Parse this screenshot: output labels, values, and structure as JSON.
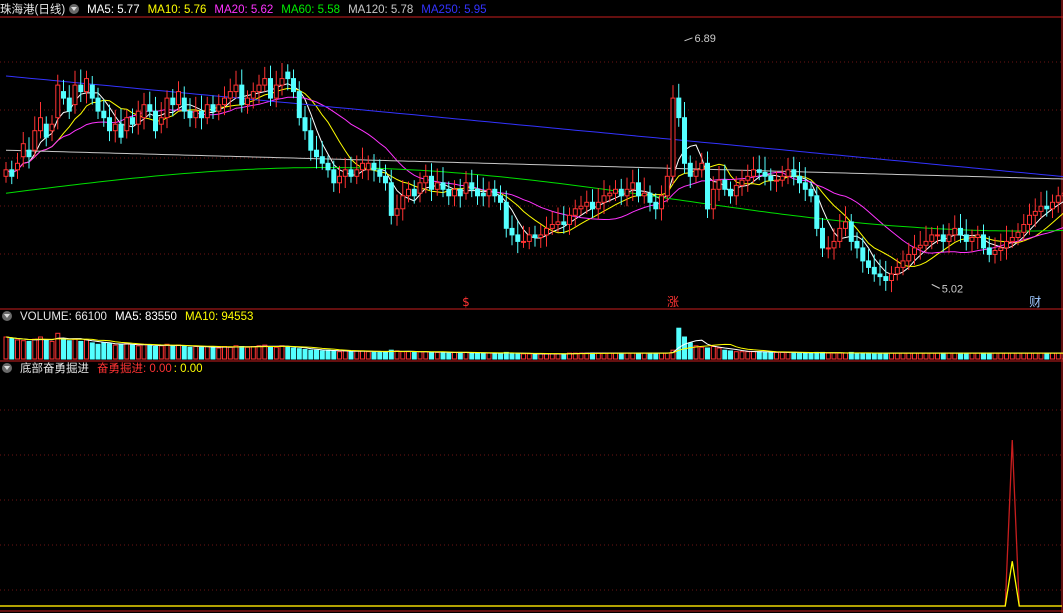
{
  "stock": {
    "title": "珠海港(日线)",
    "ma5": "MA5: 5.77",
    "ma10": "MA10: 5.76",
    "ma20": "MA20: 5.62",
    "ma60": "MA60: 5.58",
    "ma120": "MA120: 5.78",
    "ma250": "MA250: 5.95"
  },
  "volume_panel": {
    "label": "VOLUME: 66100",
    "ma5": "MA5: 83550",
    "ma10": "MA10: 94553"
  },
  "indicator_panel": {
    "label": "底部奋勇掘进",
    "line1": "奋勇掘进: 0.00",
    "line2": ": 0.00"
  },
  "colors": {
    "background": "#000000",
    "frame": "#c81e1e",
    "up": "#ff3333",
    "down": "#54ffff",
    "ma5": "#ffffff",
    "ma10": "#ffff00",
    "ma20": "#ff33ff",
    "ma60": "#00e000",
    "ma120": "#c8c8c8",
    "ma250": "#3333ff",
    "text": "#e6e6e6"
  },
  "chart_data": [
    {
      "type": "candlestick",
      "title": "珠海港(日线)",
      "ylim": [
        4.9,
        7.05
      ],
      "grid": true,
      "annotations": [
        {
          "text": "6.89",
          "bar": 118,
          "value": 6.89
        },
        {
          "text": "5.02",
          "bar": 161,
          "value": 5.02
        },
        {
          "text": "$",
          "bar": 80,
          "kind": "marker"
        },
        {
          "text": "涨",
          "bar": 116,
          "kind": "marker"
        },
        {
          "text": "财",
          "bar": 179,
          "kind": "marker"
        }
      ],
      "close": [
        5.9,
        5.85,
        5.95,
        6.1,
        6.0,
        6.2,
        6.3,
        6.15,
        6.25,
        6.55,
        6.45,
        6.35,
        6.55,
        6.5,
        6.6,
        6.45,
        6.35,
        6.3,
        6.2,
        6.25,
        6.15,
        6.3,
        6.25,
        6.35,
        6.4,
        6.35,
        6.2,
        6.3,
        6.45,
        6.4,
        6.5,
        6.35,
        6.3,
        6.35,
        6.3,
        6.4,
        6.35,
        6.4,
        6.45,
        6.5,
        6.55,
        6.4,
        6.45,
        6.5,
        6.55,
        6.6,
        6.45,
        6.55,
        6.6,
        6.6,
        6.5,
        6.3,
        6.2,
        6.05,
        6.0,
        5.95,
        5.9,
        5.8,
        5.85,
        5.9,
        5.85,
        5.9,
        5.95,
        5.95,
        5.9,
        5.85,
        5.8,
        5.55,
        5.6,
        5.7,
        5.75,
        5.7,
        5.8,
        5.85,
        5.75,
        5.8,
        5.75,
        5.7,
        5.75,
        5.7,
        5.8,
        5.75,
        5.7,
        5.7,
        5.75,
        5.7,
        5.65,
        5.45,
        5.4,
        5.35,
        5.35,
        5.4,
        5.38,
        5.4,
        5.45,
        5.48,
        5.5,
        5.48,
        5.55,
        5.6,
        5.62,
        5.65,
        5.6,
        5.65,
        5.7,
        5.72,
        5.75,
        5.7,
        5.75,
        5.8,
        5.7,
        5.72,
        5.65,
        5.6,
        5.7,
        5.85,
        6.45,
        6.3,
        5.95,
        5.85,
        5.9,
        5.95,
        5.6,
        5.75,
        5.82,
        5.75,
        5.7,
        5.78,
        5.82,
        5.85,
        5.9,
        5.88,
        5.85,
        5.82,
        5.82,
        5.85,
        5.9,
        5.85,
        5.8,
        5.75,
        5.7,
        5.45,
        5.3,
        5.3,
        5.35,
        5.45,
        5.5,
        5.35,
        5.3,
        5.2,
        5.15,
        5.1,
        5.08,
        5.05,
        5.1,
        5.15,
        5.2,
        5.25,
        5.3,
        5.32,
        5.35,
        5.4,
        5.4,
        5.35,
        5.4,
        5.45,
        5.4,
        5.35,
        5.38,
        5.4,
        5.3,
        5.25,
        5.28,
        5.3,
        5.35,
        5.38,
        5.42,
        5.48,
        5.55,
        5.58,
        5.62,
        5.6,
        5.65,
        5.7,
        5.72,
        5.68,
        5.7,
        5.72,
        5.75,
        5.78,
        5.76,
        5.78,
        5.77
      ],
      "open": [
        5.85,
        5.9,
        5.9,
        6.0,
        6.05,
        6.05,
        6.2,
        6.25,
        6.2,
        6.3,
        6.5,
        6.45,
        6.4,
        6.55,
        6.5,
        6.55,
        6.45,
        6.35,
        6.3,
        6.2,
        6.25,
        6.2,
        6.3,
        6.25,
        6.3,
        6.4,
        6.35,
        6.25,
        6.3,
        6.45,
        6.4,
        6.45,
        6.35,
        6.3,
        6.35,
        6.3,
        6.4,
        6.35,
        6.4,
        6.45,
        6.5,
        6.55,
        6.4,
        6.45,
        6.5,
        6.55,
        6.6,
        6.45,
        6.55,
        6.65,
        6.6,
        6.5,
        6.3,
        6.2,
        6.05,
        6.0,
        5.95,
        5.9,
        5.8,
        5.85,
        5.9,
        5.85,
        5.9,
        5.9,
        5.95,
        5.9,
        5.85,
        5.8,
        5.55,
        5.6,
        5.7,
        5.75,
        5.72,
        5.8,
        5.85,
        5.75,
        5.8,
        5.75,
        5.7,
        5.75,
        5.72,
        5.8,
        5.75,
        5.72,
        5.7,
        5.75,
        5.7,
        5.65,
        5.45,
        5.4,
        5.35,
        5.35,
        5.4,
        5.38,
        5.4,
        5.45,
        5.48,
        5.5,
        5.48,
        5.55,
        5.6,
        5.62,
        5.65,
        5.6,
        5.65,
        5.7,
        5.72,
        5.75,
        5.7,
        5.75,
        5.8,
        5.7,
        5.72,
        5.65,
        5.6,
        5.7,
        5.85,
        6.45,
        6.3,
        5.95,
        5.85,
        5.9,
        5.95,
        5.6,
        5.75,
        5.82,
        5.75,
        5.7,
        5.78,
        5.82,
        5.85,
        5.9,
        5.88,
        5.85,
        5.82,
        5.82,
        5.85,
        5.9,
        5.85,
        5.8,
        5.75,
        5.7,
        5.45,
        5.3,
        5.3,
        5.35,
        5.45,
        5.5,
        5.35,
        5.3,
        5.2,
        5.15,
        5.1,
        5.08,
        5.05,
        5.1,
        5.15,
        5.2,
        5.25,
        5.3,
        5.32,
        5.35,
        5.4,
        5.4,
        5.35,
        5.4,
        5.45,
        5.4,
        5.35,
        5.38,
        5.4,
        5.3,
        5.25,
        5.28,
        5.3,
        5.35,
        5.38,
        5.42,
        5.48,
        5.55,
        5.58,
        5.62,
        5.6,
        5.65,
        5.7,
        5.72,
        5.68,
        5.7,
        5.72,
        5.75,
        5.78,
        5.76,
        5.78
      ],
      "vol": [
        30,
        28,
        26,
        25,
        24,
        27,
        30,
        26,
        24,
        35,
        28,
        25,
        27,
        24,
        26,
        22,
        20,
        22,
        21,
        19,
        20,
        21,
        19,
        18,
        20,
        19,
        17,
        18,
        20,
        18,
        19,
        17,
        16,
        17,
        16,
        17,
        16,
        15,
        17,
        16,
        18,
        17,
        16,
        17,
        18,
        19,
        17,
        16,
        18,
        17,
        15,
        14,
        13,
        12,
        12,
        11,
        12,
        11,
        10,
        11,
        10,
        11,
        11,
        10,
        10,
        9,
        10,
        12,
        11,
        10,
        10,
        9,
        10,
        10,
        9,
        9,
        9,
        8,
        9,
        9,
        9,
        8,
        8,
        8,
        8,
        8,
        8,
        9,
        8,
        7,
        7,
        7,
        7,
        7,
        7,
        7,
        7,
        7,
        8,
        8,
        8,
        8,
        8,
        8,
        8,
        8,
        8,
        8,
        8,
        8,
        8,
        8,
        8,
        8,
        8,
        8,
        12,
        42,
        30,
        22,
        18,
        16,
        15,
        17,
        15,
        12,
        11,
        10,
        10,
        10,
        10,
        10,
        9,
        9,
        9,
        9,
        9,
        9,
        8,
        8,
        8,
        9,
        9,
        8,
        8,
        8,
        8,
        9,
        8,
        8,
        8,
        8,
        8,
        8,
        8,
        8,
        8,
        8,
        8,
        8,
        8,
        8,
        8,
        8,
        8,
        8,
        8,
        8,
        8,
        8,
        8,
        8,
        8,
        8,
        8,
        8,
        8,
        8,
        8,
        8,
        8,
        8,
        8,
        8,
        8,
        8,
        8,
        8,
        8,
        8,
        8,
        8,
        8,
        8,
        8,
        8,
        8,
        8
      ],
      "series": [
        {
          "name": "MA5",
          "color": "#ffffff"
        },
        {
          "name": "MA10",
          "color": "#ffff00"
        },
        {
          "name": "MA20",
          "color": "#ff33ff"
        },
        {
          "name": "MA60",
          "color": "#00e000"
        },
        {
          "name": "MA120",
          "color": "#c8c8c8"
        },
        {
          "name": "MA250",
          "color": "#3333ff"
        }
      ]
    },
    {
      "type": "line",
      "title": "底部奋勇掘进",
      "series": [
        {
          "name": "奋勇掘进",
          "color": "#c81e1e",
          "peak_bar": 175,
          "peak_value": 1.0
        },
        {
          "name": "",
          "color": "#ffff00",
          "peak_bar": 175,
          "peak_value": 0.27
        }
      ]
    }
  ]
}
